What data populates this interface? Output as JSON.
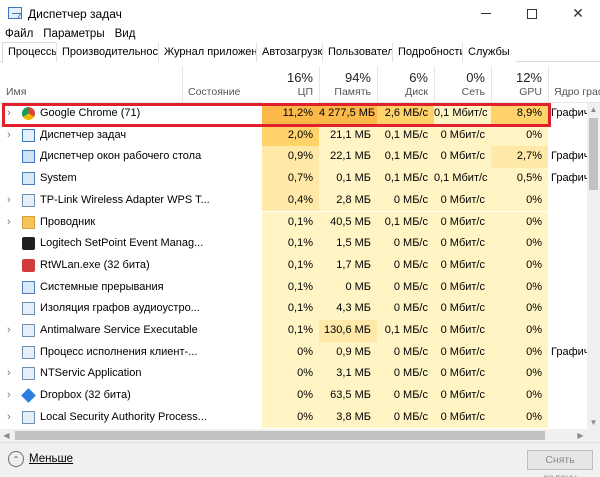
{
  "window": {
    "title": "Диспетчер задач"
  },
  "menu": [
    "Файл",
    "Параметры",
    "Вид"
  ],
  "tabs": [
    "Процессы",
    "Производительность",
    "Журнал приложений",
    "Автозагрузка",
    "Пользователи",
    "Подробности",
    "Службы"
  ],
  "columns": {
    "name": "Имя",
    "state": "Состояние",
    "cpu": {
      "pct": "16%",
      "label": "ЦП"
    },
    "memory": {
      "pct": "94%",
      "label": "Память"
    },
    "disk": {
      "pct": "6%",
      "label": "Диск"
    },
    "network": {
      "pct": "0%",
      "label": "Сеть"
    },
    "gpu": {
      "pct": "12%",
      "label": "GPU"
    },
    "gpu_engine": "Ядро графиче"
  },
  "processes": [
    {
      "name": "Google Chrome (71)",
      "icon": "chrome-icon",
      "expand": true,
      "cpu": "11,2%",
      "mem": "4 277,5 МБ",
      "disk": "2,6 МБ/с",
      "net": "0,1 Мбит/с",
      "gpu": "8,9%",
      "eng": "Графичес"
    },
    {
      "name": "Диспетчер задач",
      "icon": "task-manager-icon",
      "expand": true,
      "cpu": "2,0%",
      "mem": "21,1 МБ",
      "disk": "0,1 МБ/с",
      "net": "0 Мбит/с",
      "gpu": "0%",
      "eng": ""
    },
    {
      "name": "Диспетчер окон рабочего стола",
      "icon": "window-icon",
      "expand": false,
      "cpu": "0,9%",
      "mem": "22,1 МБ",
      "disk": "0,1 МБ/с",
      "net": "0 Мбит/с",
      "gpu": "2,7%",
      "eng": "Графичес"
    },
    {
      "name": "System",
      "icon": "system-icon",
      "expand": false,
      "cpu": "0,7%",
      "mem": "0,1 МБ",
      "disk": "0,1 МБ/с",
      "net": "0,1 Мбит/с",
      "gpu": "0,5%",
      "eng": "Графичес"
    },
    {
      "name": "TP-Link Wireless Adapter WPS T...",
      "icon": "app-icon",
      "expand": true,
      "cpu": "0,4%",
      "mem": "2,8 МБ",
      "disk": "0 МБ/с",
      "net": "0 Мбит/с",
      "gpu": "0%",
      "eng": ""
    },
    {
      "name": "Проводник",
      "icon": "folder-icon",
      "expand": true,
      "cpu": "0,1%",
      "mem": "40,5 МБ",
      "disk": "0,1 МБ/с",
      "net": "0 Мбит/с",
      "gpu": "0%",
      "eng": ""
    },
    {
      "name": "Logitech SetPoint Event Manag...",
      "icon": "logitech-icon",
      "expand": false,
      "cpu": "0,1%",
      "mem": "1,5 МБ",
      "disk": "0 МБ/с",
      "net": "0 Мбит/с",
      "gpu": "0%",
      "eng": ""
    },
    {
      "name": "RtWLan.exe (32 бита)",
      "icon": "wifi-icon",
      "expand": false,
      "cpu": "0,1%",
      "mem": "1,7 МБ",
      "disk": "0 МБ/с",
      "net": "0 Мбит/с",
      "gpu": "0%",
      "eng": ""
    },
    {
      "name": "Системные прерывания",
      "icon": "system-icon",
      "expand": false,
      "cpu": "0,1%",
      "mem": "0 МБ",
      "disk": "0 МБ/с",
      "net": "0 Мбит/с",
      "gpu": "0%",
      "eng": ""
    },
    {
      "name": "Изоляция графов аудиоустро...",
      "icon": "audio-icon",
      "expand": false,
      "cpu": "0,1%",
      "mem": "4,3 МБ",
      "disk": "0 МБ/с",
      "net": "0 Мбит/с",
      "gpu": "0%",
      "eng": ""
    },
    {
      "name": "Antimalware Service Executable",
      "icon": "app-icon",
      "expand": true,
      "cpu": "0,1%",
      "mem": "130,6 МБ",
      "disk": "0,1 МБ/с",
      "net": "0 Мбит/с",
      "gpu": "0%",
      "eng": ""
    },
    {
      "name": "Процесс исполнения клиент-...",
      "icon": "app-icon",
      "expand": false,
      "cpu": "0%",
      "mem": "0,9 МБ",
      "disk": "0 МБ/с",
      "net": "0 Мбит/с",
      "gpu": "0%",
      "eng": "Графичес"
    },
    {
      "name": "NTServic Application",
      "icon": "app-icon",
      "expand": true,
      "cpu": "0%",
      "mem": "3,1 МБ",
      "disk": "0 МБ/с",
      "net": "0 Мбит/с",
      "gpu": "0%",
      "eng": ""
    },
    {
      "name": "Dropbox (32 бита)",
      "icon": "dropbox-icon",
      "expand": true,
      "cpu": "0%",
      "mem": "63,5 МБ",
      "disk": "0 МБ/с",
      "net": "0 Мбит/с",
      "gpu": "0%",
      "eng": ""
    },
    {
      "name": "Local Security Authority Process...",
      "icon": "app-icon",
      "expand": true,
      "cpu": "0%",
      "mem": "3,8 МБ",
      "disk": "0 МБ/с",
      "net": "0 Мбит/с",
      "gpu": "0%",
      "eng": ""
    }
  ],
  "footer": {
    "less": "Меньше",
    "end_task": "Снять задачу"
  },
  "colors": {
    "highlight": "#e0202a",
    "heat_hot": "#fcb94a",
    "heat_light": "#fff4c4"
  }
}
